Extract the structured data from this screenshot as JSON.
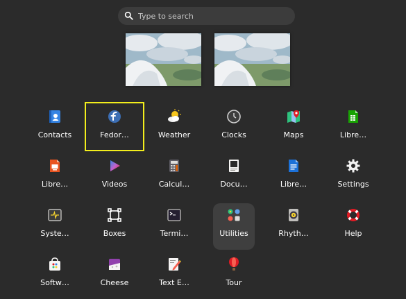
{
  "search": {
    "placeholder": "Type to search",
    "icon": "search-icon"
  },
  "workspaces": [
    {
      "label": "workspace-1"
    },
    {
      "label": "workspace-2"
    }
  ],
  "colors": {
    "background": "#2b2b2b",
    "search_bg": "#3c3c3c",
    "selection_outline": "#f3ee1c",
    "highlight_bg": "#3f3f3f"
  },
  "apps": [
    {
      "label": "Contacts",
      "icon": "contacts-icon"
    },
    {
      "label": "Fedor…",
      "icon": "fedora-icon",
      "selected": true
    },
    {
      "label": "Weather",
      "icon": "weather-icon"
    },
    {
      "label": "Clocks",
      "icon": "clocks-icon"
    },
    {
      "label": "Maps",
      "icon": "maps-icon"
    },
    {
      "label": "Libre…",
      "icon": "libreoffice-calc-icon"
    },
    {
      "label": "Libre…",
      "icon": "libreoffice-impress-icon"
    },
    {
      "label": "Videos",
      "icon": "videos-icon"
    },
    {
      "label": "Calcul…",
      "icon": "calculator-icon"
    },
    {
      "label": "Docu…",
      "icon": "document-viewer-icon"
    },
    {
      "label": "Libre…",
      "icon": "libreoffice-writer-icon"
    },
    {
      "label": "Settings",
      "icon": "settings-icon"
    },
    {
      "label": "Syste…",
      "icon": "system-monitor-icon"
    },
    {
      "label": "Boxes",
      "icon": "boxes-icon"
    },
    {
      "label": "Termi…",
      "icon": "terminal-icon"
    },
    {
      "label": "Utilities",
      "icon": "utilities-folder-icon",
      "highlighted": true
    },
    {
      "label": "Rhyth…",
      "icon": "rhythmbox-icon"
    },
    {
      "label": "Help",
      "icon": "help-icon"
    },
    {
      "label": "Softw…",
      "icon": "software-icon"
    },
    {
      "label": "Cheese",
      "icon": "cheese-icon"
    },
    {
      "label": "Text E…",
      "icon": "text-editor-icon"
    },
    {
      "label": "Tour",
      "icon": "tour-icon"
    }
  ]
}
